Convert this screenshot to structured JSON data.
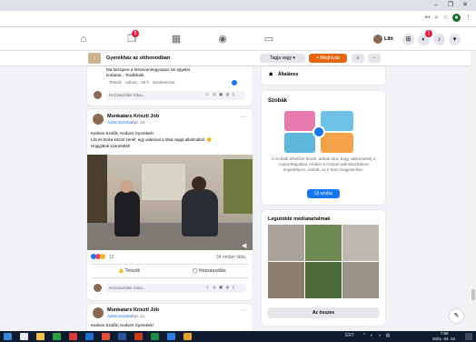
{
  "browser": {
    "window_controls": [
      "–",
      "❐",
      "✕"
    ],
    "toolbar_icons": [
      "back-icon",
      "star-icon",
      "extension-icon",
      "profile-icon",
      "menu-icon"
    ]
  },
  "facebook": {
    "nav_badge_1": "5",
    "nav_badge_2": "1",
    "user_name": "Lilit",
    "header_icons": [
      "home-icon",
      "messenger-badge-icon",
      "marketplace-icon",
      "groups-icon",
      "gaming-icon"
    ]
  },
  "group": {
    "name": "Gyerekház az otthonodban",
    "joined_label": "Tagja vagy",
    "invite_label": "Meghívás"
  },
  "prev_post": {
    "text_line1": "Ma beszgrve a tészevonóegyoppoi ssi egyebo",
    "text_line2": "kortanai... Továbbiak",
    "meta": "Tetszik · Válasz · 20 h · Szerkesztve",
    "comment_placeholder": "Hozzászólás írása..."
  },
  "post1": {
    "author": "Munkatars Kriszti Jób",
    "role": "Adminisztrátor",
    "time": "Ápr. 22.",
    "line1": "Kedves Szülők, Kedves Gyerekek!",
    "line2": "Lilit és Erika közös zenél: egy videóval a ritka napjá alkalmából. 😊",
    "line3": "Hogyjátok szeretettel!",
    "reaction_count": "12",
    "views": "34 ember látta",
    "like_label": "Tetszik",
    "comment_label": "Hozzászólás",
    "comment_placeholder": "Hozzászólás írása..."
  },
  "post2": {
    "author": "Munkatars Kriszti Jób",
    "role": "Adminisztrátor",
    "time": "Ápr. 21.",
    "line1": "Kedves Szülők, Kedves Gyerekek!"
  },
  "sidebar": {
    "general_label": "Általános",
    "rooms_title": "Szobák",
    "rooms_text": "A szobák lehetővé teszik, adnak arra, hogy videócsetelj a csoporttagokkal. Amikor a csoport adminisztrátora engedélyezi, szobát, az ír lesz megjelenítve.",
    "rooms_button": "Új szoba",
    "media_title": "Legutóbbi médiatartalmak",
    "all_button": "Az összes"
  },
  "taskbar": {
    "tray_text": "ÉRT",
    "clock_time": "7:56",
    "clock_date": "2021. 04. 22."
  },
  "colors": {
    "fb_blue": "#1877f2",
    "orange": "#e4660f",
    "header_bg": "#ffffff",
    "page_bg": "#f0f2f5",
    "taskbar": "#0f1b2e"
  }
}
